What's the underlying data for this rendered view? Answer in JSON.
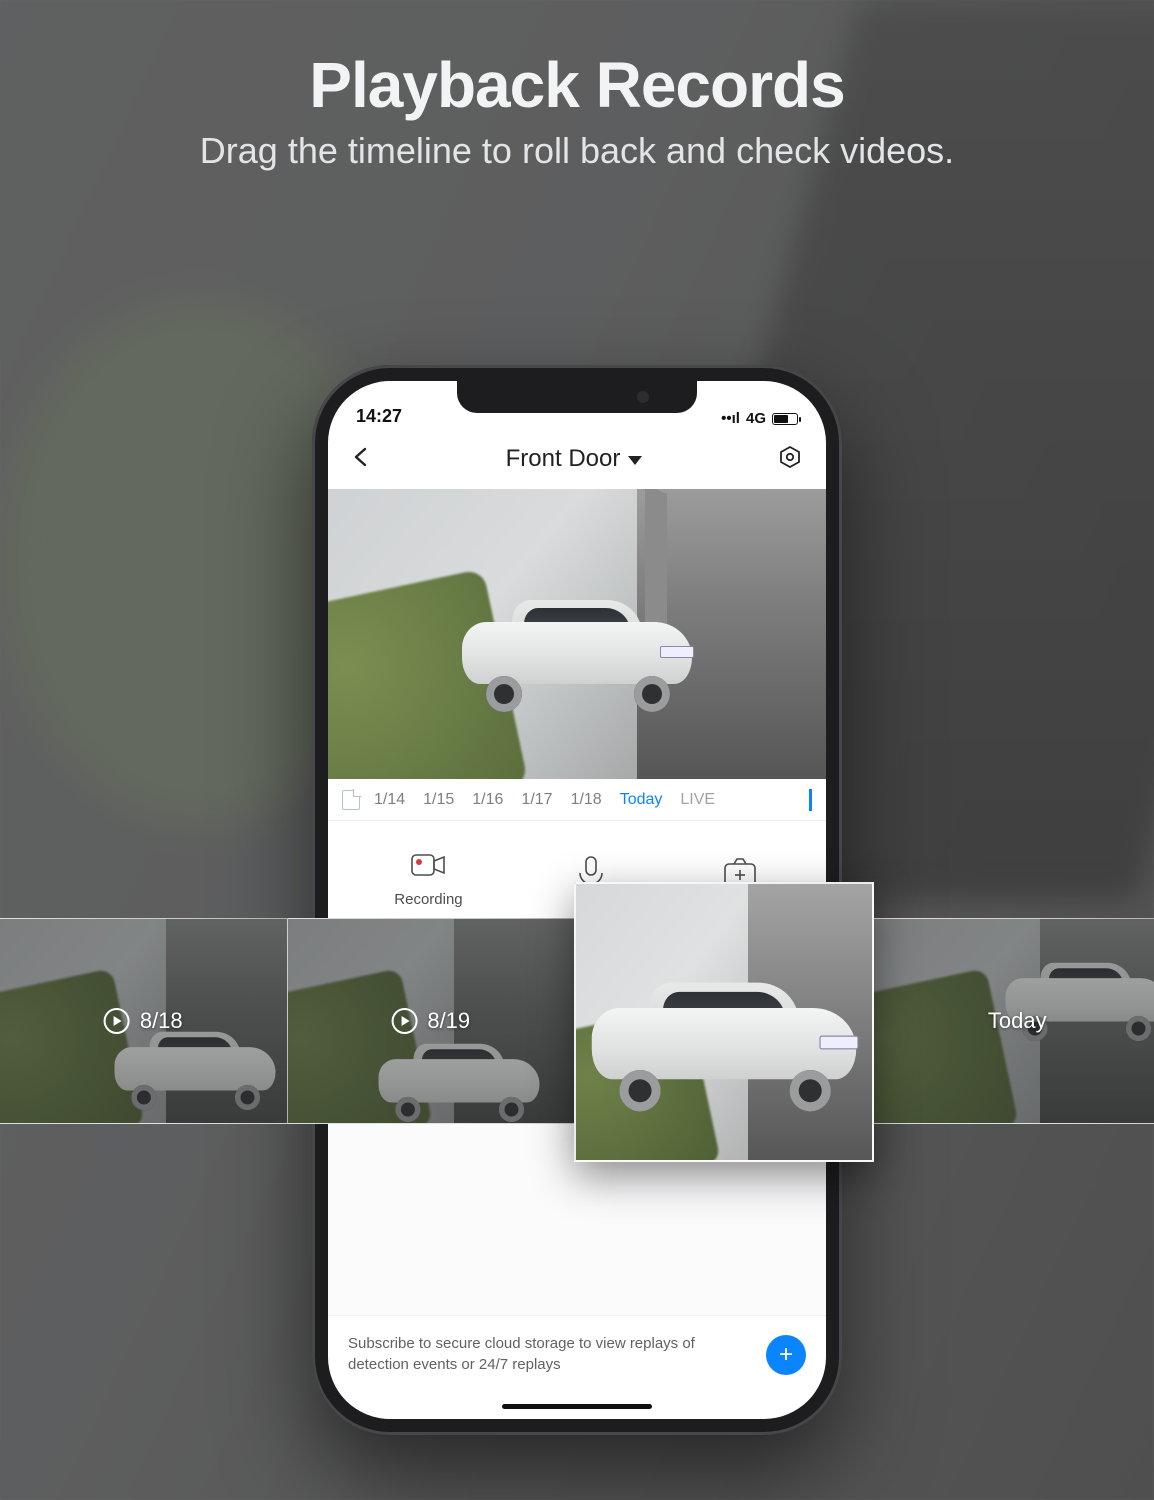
{
  "hero": {
    "title": "Playback Records",
    "subtitle": "Drag the timeline to roll back and check videos."
  },
  "status": {
    "time": "14:27",
    "network": "4G"
  },
  "nav": {
    "camera_name": "Front Door"
  },
  "date_row": {
    "items": [
      "1/14",
      "1/15",
      "1/16",
      "1/17",
      "1/18",
      "Today",
      "LIVE"
    ],
    "active_index": 5
  },
  "actions": {
    "record": "Recording",
    "mic": "",
    "snapshot": ""
  },
  "banner": {
    "text": "Subscribe to secure cloud storage to view replays of detection events or 24/7 replays"
  },
  "timeline": {
    "cards": [
      {
        "label": "8/18",
        "play": true
      },
      {
        "label": "8/19",
        "play": true
      },
      {
        "label": "",
        "play": false
      },
      {
        "label": "Today",
        "play": false
      }
    ],
    "selected_index": 2
  }
}
